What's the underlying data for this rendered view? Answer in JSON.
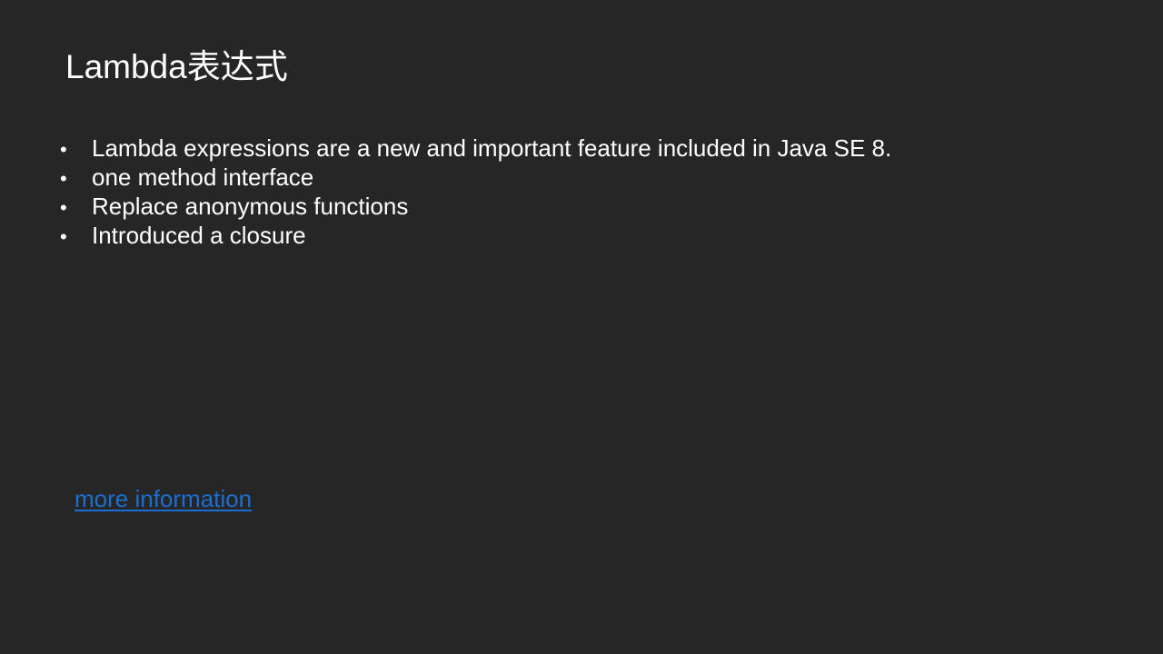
{
  "slide": {
    "title": "Lambda表达式",
    "bullet_symbol": "•",
    "bullets": [
      "Lambda expressions are a new and important feature included in Java SE 8.",
      "one method interface",
      "Replace anonymous functions",
      "Introduced a closure"
    ],
    "link_label": "more information"
  },
  "colors": {
    "background": "#262626",
    "text": "#ffffff",
    "link": "#1a6fd1"
  }
}
